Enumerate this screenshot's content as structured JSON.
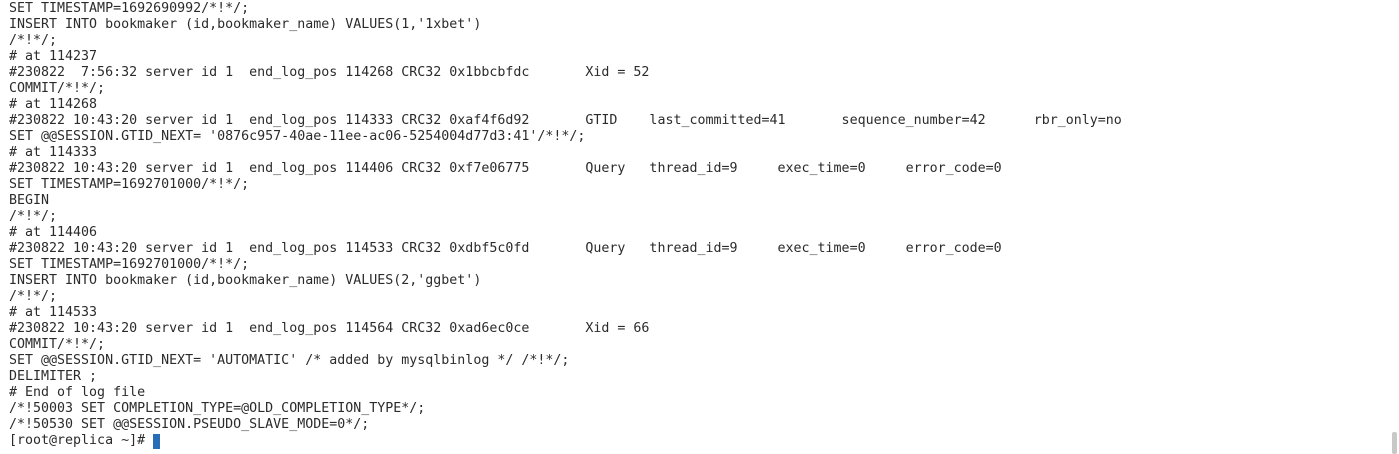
{
  "terminal": {
    "lines": [
      "SET TIMESTAMP=1692690992/*!*/;",
      "INSERT INTO bookmaker (id,bookmaker_name) VALUES(1,'1xbet')",
      "/*!*/;",
      "# at 114237",
      "#230822  7:56:32 server id 1  end_log_pos 114268 CRC32 0x1bbcbfdc       Xid = 52",
      "COMMIT/*!*/;",
      "# at 114268",
      "#230822 10:43:20 server id 1  end_log_pos 114333 CRC32 0xaf4f6d92       GTID    last_committed=41       sequence_number=42      rbr_only=no",
      "SET @@SESSION.GTID_NEXT= '0876c957-40ae-11ee-ac06-5254004d77d3:41'/*!*/;",
      "# at 114333",
      "#230822 10:43:20 server id 1  end_log_pos 114406 CRC32 0xf7e06775       Query   thread_id=9     exec_time=0     error_code=0",
      "SET TIMESTAMP=1692701000/*!*/;",
      "BEGIN",
      "/*!*/;",
      "# at 114406",
      "#230822 10:43:20 server id 1  end_log_pos 114533 CRC32 0xdbf5c0fd       Query   thread_id=9     exec_time=0     error_code=0",
      "SET TIMESTAMP=1692701000/*!*/;",
      "INSERT INTO bookmaker (id,bookmaker_name) VALUES(2,'ggbet')",
      "/*!*/;",
      "# at 114533",
      "#230822 10:43:20 server id 1  end_log_pos 114564 CRC32 0xad6ec0ce       Xid = 66",
      "COMMIT/*!*/;",
      "SET @@SESSION.GTID_NEXT= 'AUTOMATIC' /* added by mysqlbinlog */ /*!*/;",
      "DELIMITER ;",
      "# End of log file",
      "/*!50003 SET COMPLETION_TYPE=@OLD_COMPLETION_TYPE*/;",
      "/*!50530 SET @@SESSION.PSEUDO_SLAVE_MODE=0*/;"
    ],
    "prompt": "[root@replica ~]#",
    "cursor_color": "#2a6db7",
    "text_color": "#2b2b2b",
    "background": "#ffffff"
  }
}
